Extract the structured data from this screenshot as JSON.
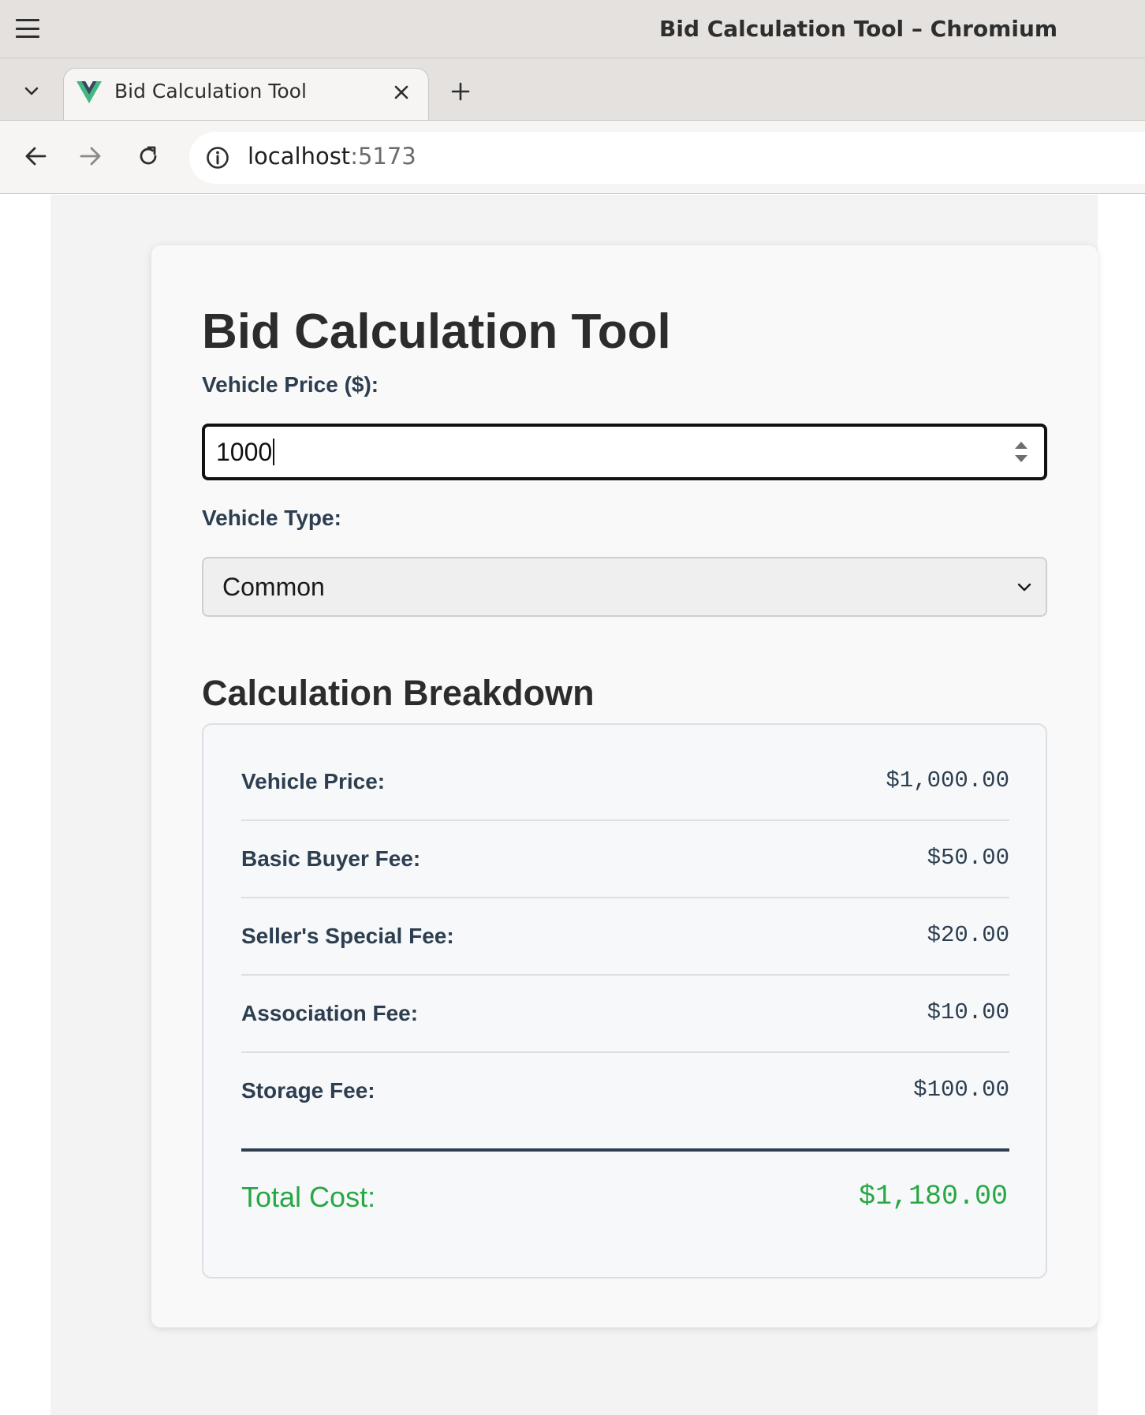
{
  "window": {
    "title": "Bid Calculation Tool – Chromium"
  },
  "tabs": [
    {
      "title": "Bid Calculation Tool",
      "favicon": "vue-logo-icon",
      "active": true
    }
  ],
  "address_bar": {
    "host": "localhost",
    "port": ":5173"
  },
  "app": {
    "title": "Bid Calculation Tool",
    "vehicle_price": {
      "label": "Vehicle Price ($):",
      "value": "1000"
    },
    "vehicle_type": {
      "label": "Vehicle Type:",
      "selected": "Common"
    },
    "breakdown": {
      "title": "Calculation Breakdown",
      "rows": [
        {
          "label": "Vehicle Price:",
          "value": "$1,000.00"
        },
        {
          "label": "Basic Buyer Fee:",
          "value": "$50.00"
        },
        {
          "label": "Seller's Special Fee:",
          "value": "$20.00"
        },
        {
          "label": "Association Fee:",
          "value": "$10.00"
        },
        {
          "label": "Storage Fee:",
          "value": "$100.00"
        }
      ],
      "total": {
        "label": "Total Cost:",
        "value": "$1,180.00"
      }
    }
  },
  "colors": {
    "total_accent": "#28a745",
    "label_text": "#2c3e50",
    "vue_green": "#41b883",
    "vue_dark": "#35495e"
  }
}
